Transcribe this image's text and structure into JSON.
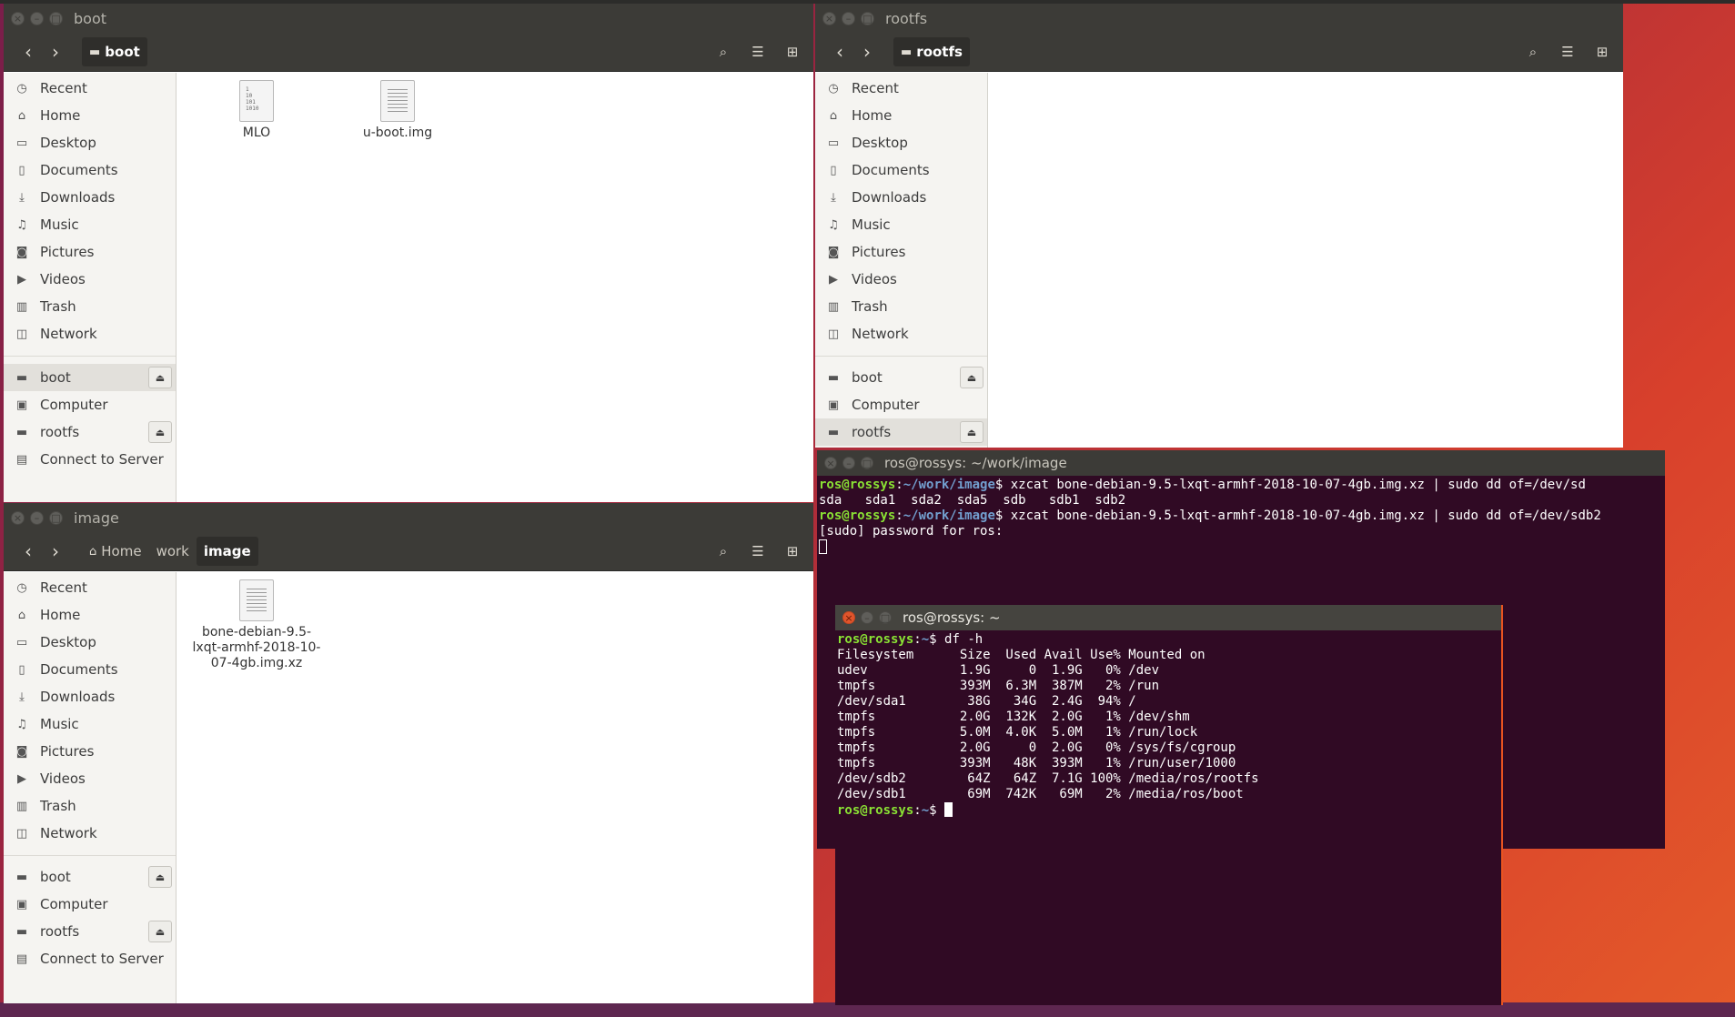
{
  "sidebar_items": [
    {
      "label": "Recent",
      "icon": "clock-icon"
    },
    {
      "label": "Home",
      "icon": "home-icon"
    },
    {
      "label": "Desktop",
      "icon": "folder-icon"
    },
    {
      "label": "Documents",
      "icon": "document-icon"
    },
    {
      "label": "Downloads",
      "icon": "download-icon"
    },
    {
      "label": "Music",
      "icon": "music-icon"
    },
    {
      "label": "Pictures",
      "icon": "camera-icon"
    },
    {
      "label": "Videos",
      "icon": "video-icon"
    },
    {
      "label": "Trash",
      "icon": "trash-icon"
    },
    {
      "label": "Network",
      "icon": "network-icon"
    }
  ],
  "devices": [
    {
      "label": "boot",
      "eject": true
    },
    {
      "label": "Computer",
      "eject": false
    },
    {
      "label": "rootfs",
      "eject": true
    },
    {
      "label": "Connect to Server",
      "eject": false
    }
  ],
  "window_boot": {
    "title": "boot",
    "crumbs": [
      "boot"
    ],
    "files": [
      {
        "name": "MLO",
        "kind": "binary"
      },
      {
        "name": "u-boot.img",
        "kind": "text"
      }
    ]
  },
  "window_rootfs": {
    "title": "rootfs",
    "crumbs": [
      "rootfs"
    ],
    "files": []
  },
  "window_image": {
    "title": "image",
    "crumbs": [
      "Home",
      "work",
      "image"
    ],
    "files": [
      {
        "name": "bone-debian-9.5-lxqt-armhf-2018-10-07-4gb.img.xz",
        "kind": "text"
      }
    ]
  },
  "binary_icon_text": "1\n10\n101\n1010",
  "terminal_image": {
    "title": "ros@rossys: ~/work/image",
    "lines": [
      {
        "user": "ros@rossys",
        "path": "~/work/image",
        "cmd": " xzcat bone-debian-9.5-lxqt-armhf-2018-10-07-4gb.img.xz | sudo dd of=/dev/sd"
      },
      {
        "text": "sda   sda1  sda2  sda5  sdb   sdb1  sdb2"
      },
      {
        "user": "ros@rossys",
        "path": "~/work/image",
        "cmd": " xzcat bone-debian-9.5-lxqt-armhf-2018-10-07-4gb.img.xz | sudo dd of=/dev/sdb2"
      },
      {
        "text": "[sudo] password for ros:"
      }
    ]
  },
  "terminal_home": {
    "title": "ros@rossys: ~",
    "prompt_user": "ros@rossys",
    "prompt_path": "~",
    "command": " df -h",
    "output": [
      "Filesystem      Size  Used Avail Use% Mounted on",
      "udev            1.9G     0  1.9G   0% /dev",
      "tmpfs           393M  6.3M  387M   2% /run",
      "/dev/sda1        38G   34G  2.4G  94% /",
      "tmpfs           2.0G  132K  2.0G   1% /dev/shm",
      "tmpfs           5.0M  4.0K  5.0M   1% /run/lock",
      "tmpfs           2.0G     0  2.0G   0% /sys/fs/cgroup",
      "tmpfs           393M   48K  393M   1% /run/user/1000",
      "/dev/sdb2        64Z   64Z  7.1G 100% /media/ros/rootfs",
      "/dev/sdb1        69M  742K   69M   2% /media/ros/boot"
    ]
  },
  "colors": {
    "prompt_user": "#8ae234",
    "prompt_path": "#729fcf",
    "terminal_bg": "#300a24",
    "accent": "#e95420"
  }
}
